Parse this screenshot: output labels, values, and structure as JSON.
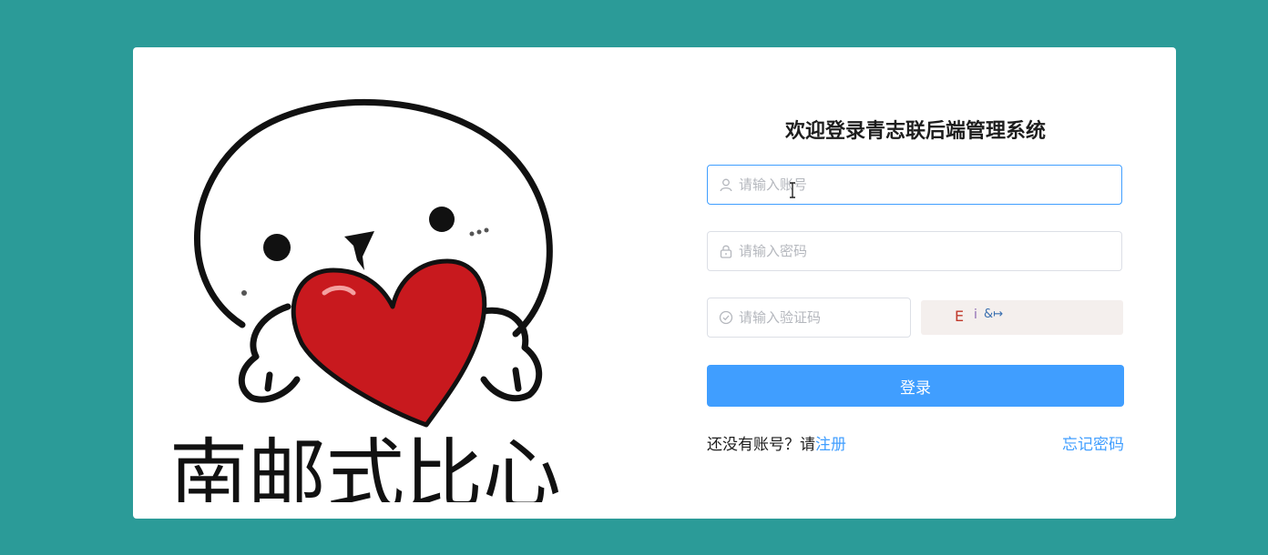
{
  "art": {
    "caption": "南邮式比心"
  },
  "login": {
    "title": "欢迎登录青志联后端管理系统",
    "username_placeholder": "请输入账号",
    "password_placeholder": "请输入密码",
    "captcha_placeholder": "请输入验证码",
    "captcha_chars": [
      "E",
      "i",
      "&↦"
    ],
    "submit_label": "登录",
    "register_prompt": "还没有账号？请",
    "register_link": "注册",
    "forgot_link": "忘记密码"
  },
  "colors": {
    "background": "#2b9b98",
    "accent": "#409eff",
    "heart": "#c8191e"
  },
  "icons": [
    "user-icon",
    "lock-icon",
    "check-circle-icon"
  ]
}
